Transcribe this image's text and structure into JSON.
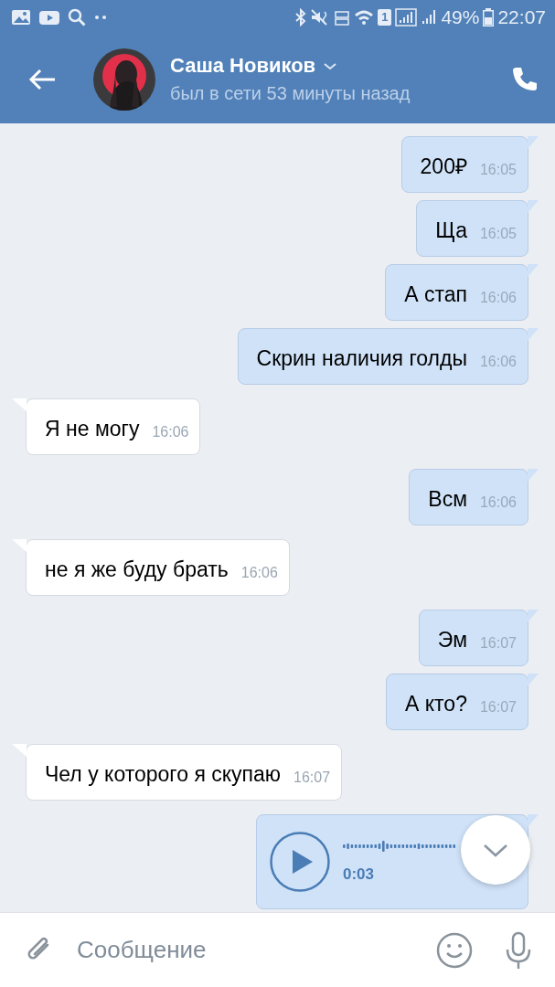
{
  "status_bar": {
    "sim": "1",
    "battery": "49%",
    "time": "22:07"
  },
  "header": {
    "name": "Саша Новиков",
    "last_seen": "был в сети 53 минуты назад"
  },
  "messages": [
    {
      "kind": "text",
      "outgoing": true,
      "text": "200₽",
      "time": "16:05"
    },
    {
      "kind": "text",
      "outgoing": true,
      "text": "Ща",
      "time": "16:05"
    },
    {
      "kind": "text",
      "outgoing": true,
      "text": "А стап",
      "time": "16:06"
    },
    {
      "kind": "text",
      "outgoing": true,
      "text": "Скрин наличия голды",
      "time": "16:06"
    },
    {
      "kind": "text",
      "outgoing": false,
      "text": "Я не могу",
      "time": "16:06"
    },
    {
      "kind": "text",
      "outgoing": true,
      "text": "Всм",
      "time": "16:06"
    },
    {
      "kind": "text",
      "outgoing": false,
      "text": "не я же буду брать",
      "time": "16:06"
    },
    {
      "kind": "text",
      "outgoing": true,
      "text": "Эм",
      "time": "16:07"
    },
    {
      "kind": "text",
      "outgoing": true,
      "text": "А кто?",
      "time": "16:07"
    },
    {
      "kind": "text",
      "outgoing": false,
      "text": "Чел у которого я скупаю",
      "time": "16:07"
    },
    {
      "kind": "voice",
      "outgoing": true,
      "duration": "0:03"
    }
  ],
  "composer": {
    "placeholder": "Сообщение"
  }
}
